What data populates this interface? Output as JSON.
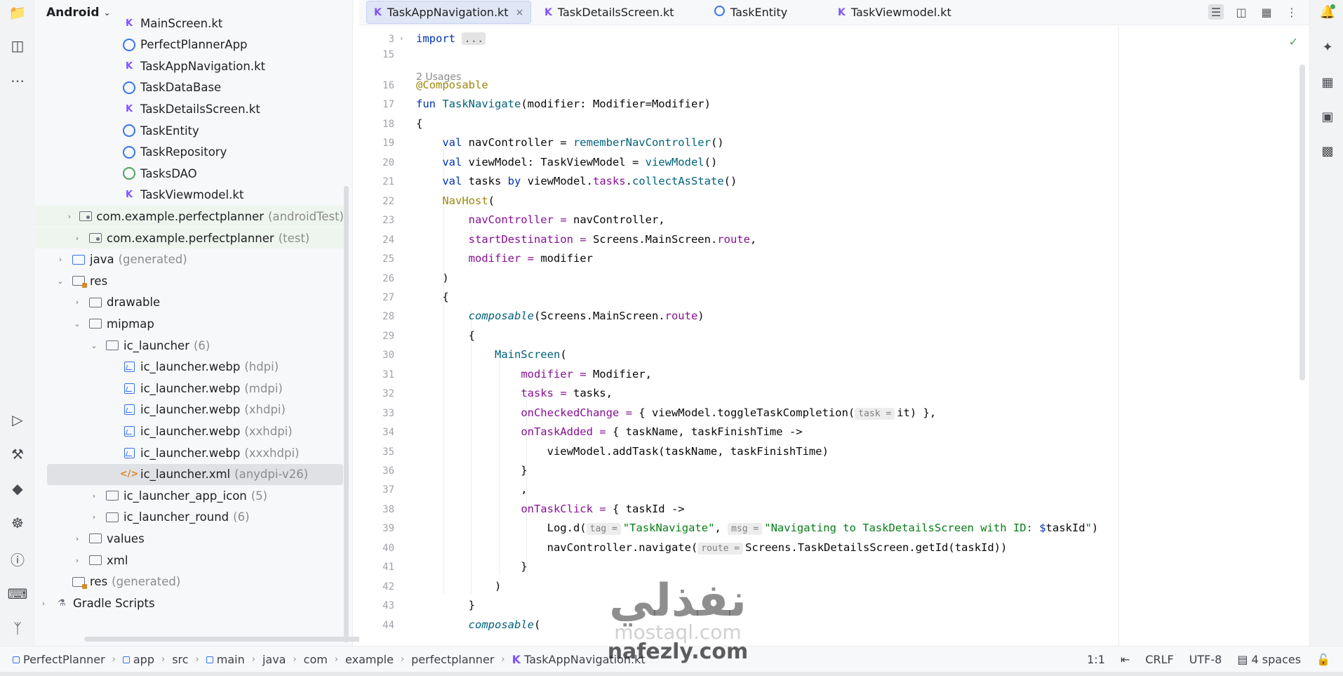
{
  "panel": {
    "title": "Android"
  },
  "tree": [
    {
      "label": "MainScreen.kt",
      "secondary": "",
      "icon": "kotlin-file-icon",
      "depth": 4,
      "arrow": ""
    },
    {
      "label": "PerfectPlannerApp",
      "secondary": "",
      "icon": "class-icon",
      "depth": 4,
      "arrow": ""
    },
    {
      "label": "TaskAppNavigation.kt",
      "secondary": "",
      "icon": "kotlin-file-icon",
      "depth": 4,
      "arrow": ""
    },
    {
      "label": "TaskDataBase",
      "secondary": "",
      "icon": "class-icon",
      "depth": 4,
      "arrow": ""
    },
    {
      "label": "TaskDetailsScreen.kt",
      "secondary": "",
      "icon": "kotlin-file-icon",
      "depth": 4,
      "arrow": ""
    },
    {
      "label": "TaskEntity",
      "secondary": "",
      "icon": "class-icon",
      "depth": 4,
      "arrow": ""
    },
    {
      "label": "TaskRepository",
      "secondary": "",
      "icon": "class-icon",
      "depth": 4,
      "arrow": ""
    },
    {
      "label": "TasksDAO",
      "secondary": "",
      "icon": "interface-icon",
      "depth": 4,
      "arrow": ""
    },
    {
      "label": "TaskViewmodel.kt",
      "secondary": "",
      "icon": "kotlin-file-icon",
      "depth": 4,
      "arrow": ""
    },
    {
      "label": "com.example.perfectplanner",
      "secondary": "(androidTest)",
      "icon": "package-icon",
      "depth": 2,
      "arrow": "›",
      "hl": true
    },
    {
      "label": "com.example.perfectplanner",
      "secondary": "(test)",
      "icon": "package-icon",
      "depth": 2,
      "arrow": "›",
      "hl": true
    },
    {
      "label": "java",
      "secondary": "(generated)",
      "icon": "generated-folder-icon",
      "depth": 1,
      "arrow": "›"
    },
    {
      "label": "res",
      "secondary": "",
      "icon": "res-folder-icon",
      "depth": 1,
      "arrow": "⌄"
    },
    {
      "label": "drawable",
      "secondary": "",
      "icon": "folder-icon",
      "depth": 2,
      "arrow": "›"
    },
    {
      "label": "mipmap",
      "secondary": "",
      "icon": "folder-icon",
      "depth": 2,
      "arrow": "⌄"
    },
    {
      "label": "ic_launcher",
      "secondary": "(6)",
      "icon": "folder-icon",
      "depth": 3,
      "arrow": "⌄"
    },
    {
      "label": "ic_launcher.webp",
      "secondary": "(hdpi)",
      "icon": "image-file-icon",
      "depth": 4,
      "arrow": ""
    },
    {
      "label": "ic_launcher.webp",
      "secondary": "(mdpi)",
      "icon": "image-file-icon",
      "depth": 4,
      "arrow": ""
    },
    {
      "label": "ic_launcher.webp",
      "secondary": "(xhdpi)",
      "icon": "image-file-icon",
      "depth": 4,
      "arrow": ""
    },
    {
      "label": "ic_launcher.webp",
      "secondary": "(xxhdpi)",
      "icon": "image-file-icon",
      "depth": 4,
      "arrow": ""
    },
    {
      "label": "ic_launcher.webp",
      "secondary": "(xxxhdpi)",
      "icon": "image-file-icon",
      "depth": 4,
      "arrow": ""
    },
    {
      "label": "ic_launcher.xml",
      "secondary": "(anydpi-v26)",
      "icon": "xml-file-icon",
      "depth": 4,
      "arrow": "",
      "selected": true
    },
    {
      "label": "ic_launcher_app_icon",
      "secondary": "(5)",
      "icon": "folder-icon",
      "depth": 3,
      "arrow": "›"
    },
    {
      "label": "ic_launcher_round",
      "secondary": "(6)",
      "icon": "folder-icon",
      "depth": 3,
      "arrow": "›"
    },
    {
      "label": "values",
      "secondary": "",
      "icon": "folder-icon",
      "depth": 2,
      "arrow": "›"
    },
    {
      "label": "xml",
      "secondary": "",
      "icon": "folder-icon",
      "depth": 2,
      "arrow": "›"
    },
    {
      "label": "res",
      "secondary": "(generated)",
      "icon": "res-folder-icon",
      "depth": 1,
      "arrow": ""
    },
    {
      "label": "Gradle Scripts",
      "secondary": "",
      "icon": "gradle-icon",
      "depth": 0,
      "arrow": "›"
    }
  ],
  "tabs": [
    {
      "label": "TaskAppNavigation.kt",
      "icon": "kotlin-file-icon",
      "active": true,
      "close": "×"
    },
    {
      "label": "TaskDetailsScreen.kt",
      "icon": "kotlin-file-icon",
      "active": false
    },
    {
      "label": "TaskEntity",
      "icon": "class-icon",
      "active": false
    },
    {
      "label": "TaskViewmodel.kt",
      "icon": "kotlin-file-icon",
      "active": false
    }
  ],
  "editor": {
    "usages_label": "2 Usages",
    "lines": [
      {
        "n": "3",
        "segs": [
          [
            "kw",
            "import "
          ],
          [
            "folded",
            "..."
          ]
        ],
        "fold": "›"
      },
      {
        "n": "15",
        "segs": []
      },
      {
        "n": "16",
        "segs": [
          [
            "ann",
            "@Composable"
          ]
        ]
      },
      {
        "n": "17",
        "segs": [
          [
            "kw",
            "fun "
          ],
          [
            "fn",
            "TaskNavigate"
          ],
          [
            "",
            "(modifier: Modifier=Modifier)"
          ]
        ]
      },
      {
        "n": "18",
        "segs": [
          [
            "",
            "{"
          ]
        ]
      },
      {
        "n": "19",
        "segs": [
          [
            "",
            "    "
          ],
          [
            "kw",
            "val "
          ],
          [
            "",
            "navController = "
          ],
          [
            "call",
            "rememberNavController"
          ],
          [
            "",
            "()"
          ]
        ]
      },
      {
        "n": "20",
        "segs": [
          [
            "",
            "    "
          ],
          [
            "kw",
            "val "
          ],
          [
            "",
            "viewModel: TaskViewModel = "
          ],
          [
            "call",
            "viewModel"
          ],
          [
            "",
            "()"
          ]
        ]
      },
      {
        "n": "21",
        "segs": [
          [
            "",
            "    "
          ],
          [
            "kw",
            "val "
          ],
          [
            "",
            "tasks "
          ],
          [
            "kw",
            "by "
          ],
          [
            "",
            "viewModel."
          ],
          [
            "prop",
            "tasks"
          ],
          [
            "",
            "."
          ],
          [
            "call",
            "collectAsState"
          ],
          [
            "",
            "()"
          ]
        ]
      },
      {
        "n": "22",
        "segs": [
          [
            "",
            "    "
          ],
          [
            "ann",
            "NavHost"
          ],
          [
            "",
            "("
          ]
        ]
      },
      {
        "n": "23",
        "segs": [
          [
            "",
            "        "
          ],
          [
            "prop",
            "navController"
          ],
          [
            "prop",
            " = "
          ],
          [
            "",
            "navController,"
          ]
        ]
      },
      {
        "n": "24",
        "segs": [
          [
            "",
            "        "
          ],
          [
            "prop",
            "startDestination"
          ],
          [
            "prop",
            " = "
          ],
          [
            "",
            "Screens.MainScreen."
          ],
          [
            "prop",
            "route"
          ],
          [
            "",
            ","
          ]
        ]
      },
      {
        "n": "25",
        "segs": [
          [
            "",
            "        "
          ],
          [
            "prop",
            "modifier"
          ],
          [
            "prop",
            " = "
          ],
          [
            "",
            "modifier"
          ]
        ]
      },
      {
        "n": "26",
        "segs": [
          [
            "",
            "    )"
          ]
        ]
      },
      {
        "n": "27",
        "segs": [
          [
            "",
            "    {"
          ]
        ]
      },
      {
        "n": "28",
        "segs": [
          [
            "",
            "        "
          ],
          [
            "ital",
            "composable"
          ],
          [
            "",
            "(Screens.MainScreen."
          ],
          [
            "prop",
            "route"
          ],
          [
            "",
            ")"
          ]
        ]
      },
      {
        "n": "29",
        "segs": [
          [
            "",
            "        {"
          ]
        ]
      },
      {
        "n": "30",
        "segs": [
          [
            "",
            "            "
          ],
          [
            "call",
            "MainScreen"
          ],
          [
            "",
            "("
          ]
        ]
      },
      {
        "n": "31",
        "segs": [
          [
            "",
            "                "
          ],
          [
            "prop",
            "modifier"
          ],
          [
            "prop",
            " = "
          ],
          [
            "",
            "Modifier,"
          ]
        ]
      },
      {
        "n": "32",
        "segs": [
          [
            "",
            "                "
          ],
          [
            "prop",
            "tasks"
          ],
          [
            "prop",
            " = "
          ],
          [
            "",
            "tasks,"
          ]
        ]
      },
      {
        "n": "33",
        "segs": [
          [
            "",
            "                "
          ],
          [
            "prop",
            "onCheckedChange"
          ],
          [
            "prop",
            " = "
          ],
          [
            "",
            "{ viewModel.toggleTaskCompletion("
          ],
          [
            "hint",
            "task ="
          ],
          [
            "",
            "it) },"
          ]
        ]
      },
      {
        "n": "34",
        "segs": [
          [
            "",
            "                "
          ],
          [
            "prop",
            "onTaskAdded"
          ],
          [
            "prop",
            " = "
          ],
          [
            "",
            "{ taskName, taskFinishTime ->"
          ]
        ]
      },
      {
        "n": "35",
        "segs": [
          [
            "",
            "                    viewModel.addTask(taskName, taskFinishTime)"
          ]
        ]
      },
      {
        "n": "36",
        "segs": [
          [
            "",
            "                }"
          ]
        ]
      },
      {
        "n": "37",
        "segs": [
          [
            "",
            "                ,"
          ]
        ]
      },
      {
        "n": "38",
        "segs": [
          [
            "",
            "                "
          ],
          [
            "prop",
            "onTaskClick"
          ],
          [
            "prop",
            " = "
          ],
          [
            "",
            "{ taskId ->"
          ]
        ]
      },
      {
        "n": "39",
        "segs": [
          [
            "",
            "                    Log.d("
          ],
          [
            "hint",
            "tag ="
          ],
          [
            "str",
            "\"TaskNavigate\""
          ],
          [
            "",
            ", "
          ],
          [
            "hint",
            "msg ="
          ],
          [
            "str",
            "\"Navigating to TaskDetailsScreen with ID: "
          ],
          [
            "kw",
            "$"
          ],
          [
            "",
            "taskId"
          ],
          [
            "str",
            "\""
          ],
          [
            "",
            ")"
          ]
        ]
      },
      {
        "n": "40",
        "segs": [
          [
            "",
            "                    navController.navigate("
          ],
          [
            "hint",
            "route ="
          ],
          [
            "",
            "Screens.TaskDetailsScreen.getId(taskId))"
          ]
        ]
      },
      {
        "n": "41",
        "segs": [
          [
            "",
            "                }"
          ]
        ]
      },
      {
        "n": "42",
        "segs": [
          [
            "",
            "            )"
          ]
        ]
      },
      {
        "n": "43",
        "segs": [
          [
            "",
            "        }"
          ]
        ]
      },
      {
        "n": "44",
        "segs": [
          [
            "",
            "        "
          ],
          [
            "ital",
            "composable"
          ],
          [
            "",
            "("
          ]
        ]
      }
    ]
  },
  "breadcrumbs": [
    {
      "label": "PerfectPlanner",
      "mod": true
    },
    {
      "label": "app",
      "mod": true
    },
    {
      "label": "src",
      "mod": false
    },
    {
      "label": "main",
      "mod": true
    },
    {
      "label": "java",
      "mod": false
    },
    {
      "label": "com",
      "mod": false
    },
    {
      "label": "example",
      "mod": false
    },
    {
      "label": "perfectplanner",
      "mod": false
    },
    {
      "label": "TaskAppNavigation.kt",
      "mod": false,
      "kt": true
    }
  ],
  "status": {
    "position": "1:1",
    "line_sep": "CRLF",
    "encoding": "UTF-8",
    "indent": "4 spaces"
  },
  "watermark": {
    "arabic": "نفذلي",
    "site1": "mostaql.com",
    "site2": "nafezly.com"
  },
  "colors": {
    "accent": "#3574f0",
    "kotlin": "#7f52ff",
    "selected": "#dfe1e5"
  }
}
